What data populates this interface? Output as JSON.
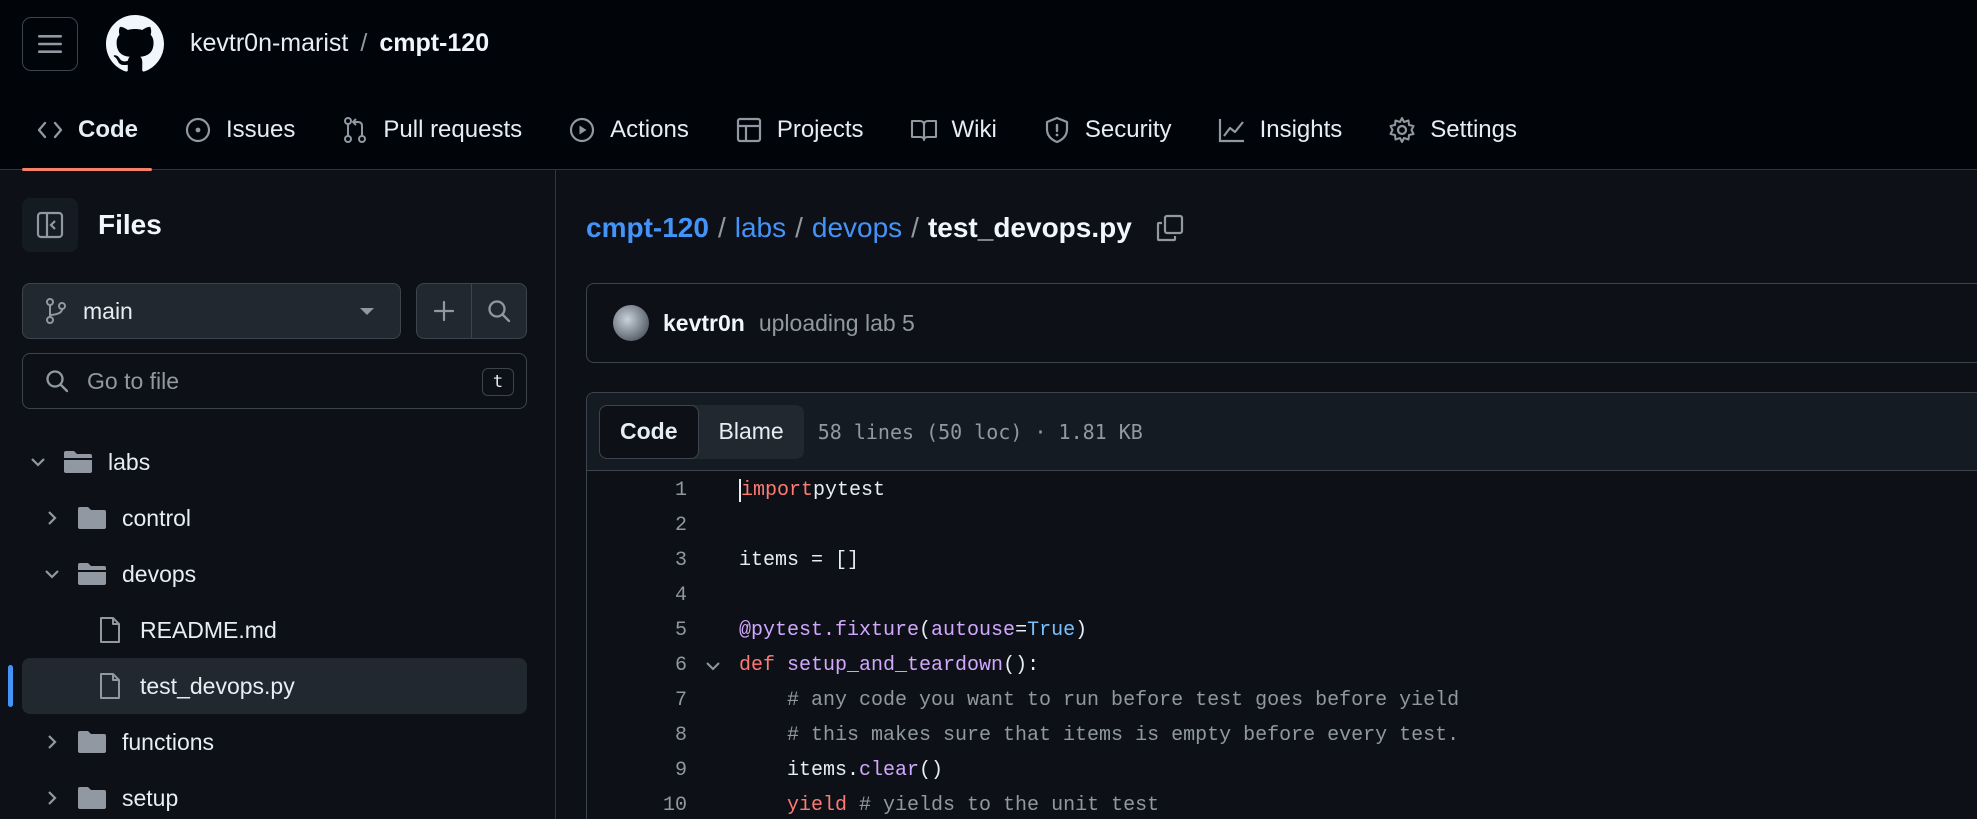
{
  "header": {
    "owner": "kevtr0n-marist",
    "separator": "/",
    "repo": "cmpt-120"
  },
  "tabs": [
    {
      "label": "Code",
      "icon": "code-icon",
      "active": true
    },
    {
      "label": "Issues",
      "icon": "issue-icon"
    },
    {
      "label": "Pull requests",
      "icon": "pull-request-icon"
    },
    {
      "label": "Actions",
      "icon": "play-icon"
    },
    {
      "label": "Projects",
      "icon": "table-icon"
    },
    {
      "label": "Wiki",
      "icon": "book-icon"
    },
    {
      "label": "Security",
      "icon": "shield-icon"
    },
    {
      "label": "Insights",
      "icon": "graph-icon"
    },
    {
      "label": "Settings",
      "icon": "gear-icon"
    }
  ],
  "sidebar": {
    "title": "Files",
    "branch": "main",
    "search_placeholder": "Go to file",
    "search_shortcut": "t",
    "tree": [
      {
        "label": "labs",
        "type": "folder",
        "expanded": true,
        "depth": 0
      },
      {
        "label": "control",
        "type": "folder",
        "expanded": false,
        "depth": 1
      },
      {
        "label": "devops",
        "type": "folder",
        "expanded": true,
        "depth": 1
      },
      {
        "label": "README.md",
        "type": "file",
        "depth": 2
      },
      {
        "label": "test_devops.py",
        "type": "file",
        "depth": 2,
        "selected": true
      },
      {
        "label": "functions",
        "type": "folder",
        "expanded": false,
        "depth": 1
      },
      {
        "label": "setup",
        "type": "folder",
        "expanded": false,
        "depth": 1
      }
    ]
  },
  "breadcrumb": {
    "repo": "cmpt-120",
    "dir1": "labs",
    "dir2": "devops",
    "file": "test_devops.py",
    "sep": "/"
  },
  "commit": {
    "author": "kevtr0n",
    "message": "uploading lab 5"
  },
  "viewer": {
    "code_tab": "Code",
    "blame_tab": "Blame",
    "meta": "58 lines (50 loc) · 1.81 KB",
    "lines": [
      {
        "n": "1",
        "tokens": [
          [
            "kw",
            "import"
          ],
          [
            "",
            "pytest"
          ]
        ]
      },
      {
        "n": "2",
        "tokens": []
      },
      {
        "n": "3",
        "tokens": [
          [
            "",
            "items = []"
          ]
        ]
      },
      {
        "n": "4",
        "tokens": []
      },
      {
        "n": "5",
        "tokens": [
          [
            "dec",
            "@pytest.fixture"
          ],
          [
            "",
            "("
          ],
          [
            "dec",
            "autouse"
          ],
          [
            "",
            "="
          ],
          [
            "bool",
            "True"
          ],
          [
            "",
            ")"
          ]
        ]
      },
      {
        "n": "6",
        "tokens": [
          [
            "kw",
            "def "
          ],
          [
            "fn",
            "setup_and_teardown"
          ],
          [
            "",
            "():"
          ]
        ],
        "fold": true
      },
      {
        "n": "7",
        "tokens": [
          [
            "cm",
            "    # any code you want to run before test goes before yield"
          ]
        ]
      },
      {
        "n": "8",
        "tokens": [
          [
            "cm",
            "    # this makes sure that items is empty before every test."
          ]
        ]
      },
      {
        "n": "9",
        "tokens": [
          [
            "",
            "    items."
          ],
          [
            "fn",
            "clear"
          ],
          [
            "",
            "()"
          ]
        ]
      },
      {
        "n": "10",
        "tokens": [
          [
            "kw",
            "    yield"
          ],
          [
            "cm",
            " # yields to the unit test"
          ]
        ]
      }
    ]
  },
  "colors": {
    "background": "#0d1117",
    "header": "#010409",
    "link": "#4493f8",
    "active_tab_underline": "#f78166"
  }
}
